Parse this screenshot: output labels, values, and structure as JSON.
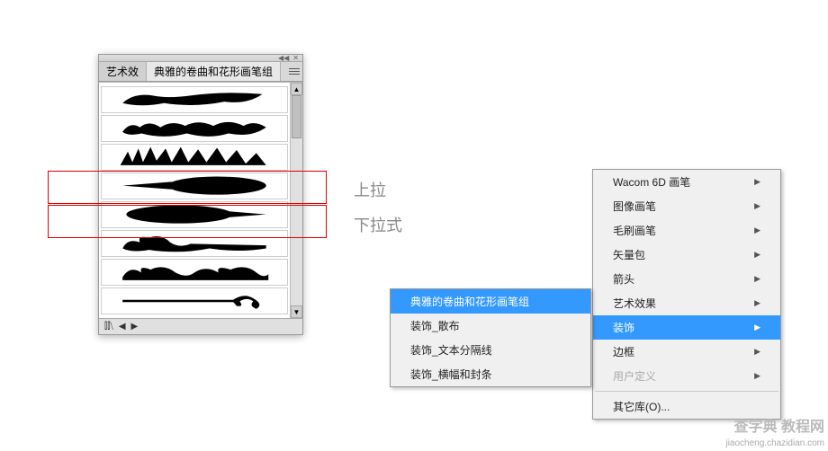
{
  "panel": {
    "tab_inactive": "艺术效",
    "tab_active": "典雅的卷曲和花形画笔组",
    "menu_icon": "menu-icon",
    "footer_icons": [
      "library",
      "prev",
      "next"
    ]
  },
  "labels": {
    "up": "上拉",
    "down": "下拉式"
  },
  "menu_primary": [
    {
      "label": "Wacom 6D 画笔",
      "sub": true
    },
    {
      "label": "图像画笔",
      "sub": true
    },
    {
      "label": "毛刷画笔",
      "sub": true
    },
    {
      "label": "矢量包",
      "sub": true
    },
    {
      "label": "箭头",
      "sub": true
    },
    {
      "label": "艺术效果",
      "sub": true
    },
    {
      "label": "装饰",
      "sub": true,
      "hl": true
    },
    {
      "label": "边框",
      "sub": true
    },
    {
      "label": "用户定义",
      "sub": true,
      "disabled": true
    },
    {
      "label": "其它库(O)...",
      "sub": false,
      "sep_before": true
    }
  ],
  "menu_sub": [
    {
      "label": "典雅的卷曲和花形画笔组",
      "hl": true
    },
    {
      "label": "装饰_散布"
    },
    {
      "label": "装饰_文本分隔线"
    },
    {
      "label": "装饰_横幅和封条"
    }
  ],
  "watermark": {
    "cn": "查字典 教程网",
    "url": "jiaocheng.chazidian.com"
  }
}
